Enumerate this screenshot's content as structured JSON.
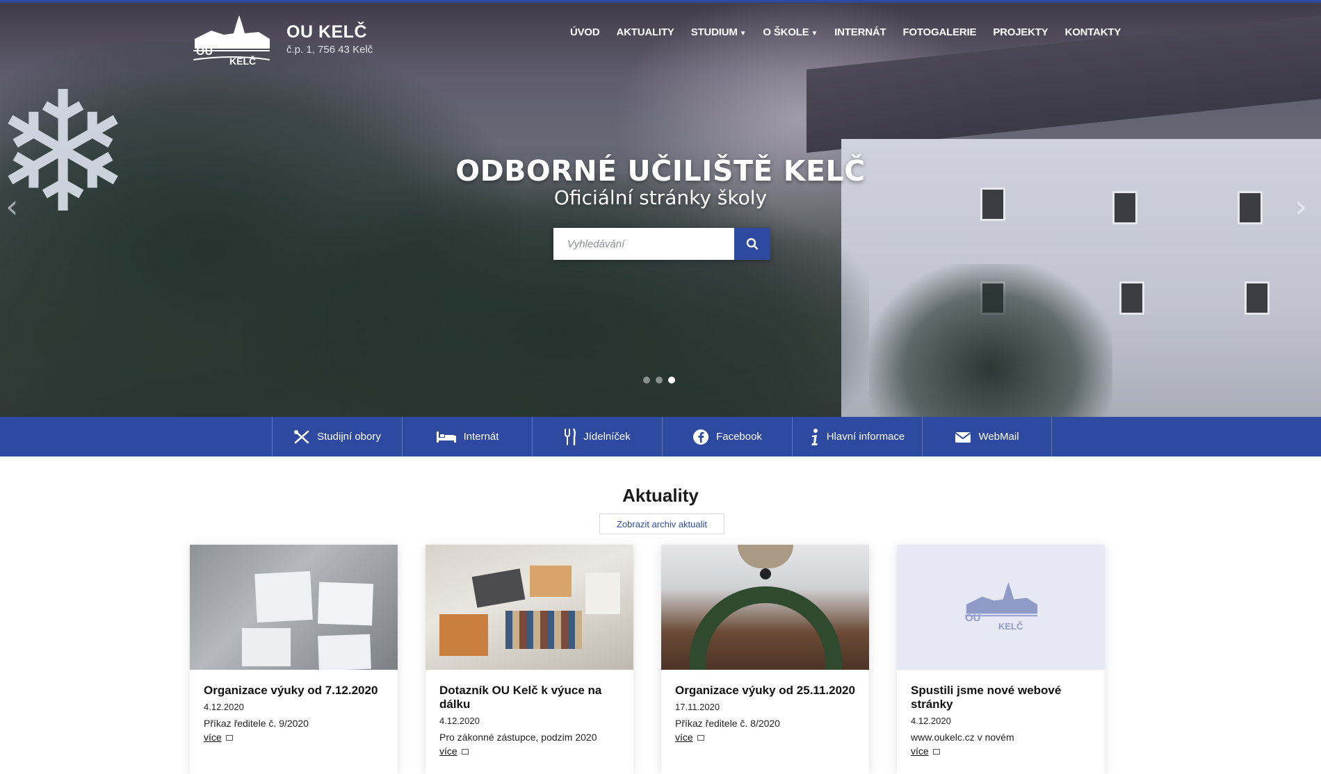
{
  "header": {
    "logo_text_top": "OU",
    "logo_text_bottom": "KELČ",
    "title": "OU KELČ",
    "subtitle": "č.p. 1, 756 43 Kelč"
  },
  "nav": [
    {
      "label": "ÚVOD",
      "dropdown": false
    },
    {
      "label": "AKTUALITY",
      "dropdown": false
    },
    {
      "label": "STUDIUM",
      "dropdown": true
    },
    {
      "label": "O ŠKOLE",
      "dropdown": true
    },
    {
      "label": "INTERNÁT",
      "dropdown": false
    },
    {
      "label": "FOTOGALERIE",
      "dropdown": false
    },
    {
      "label": "PROJEKTY",
      "dropdown": false
    },
    {
      "label": "KONTAKTY",
      "dropdown": false
    }
  ],
  "hero": {
    "title": "ODBORNÉ UČILIŠTĚ KELČ",
    "subtitle": "Oficiální stránky školy",
    "search_placeholder": "Vyhledávání",
    "slide_count": 3,
    "active_slide": 3
  },
  "quicklinks": [
    {
      "label": "Studijní obory",
      "icon": "tools-icon"
    },
    {
      "label": "Internát",
      "icon": "bed-icon"
    },
    {
      "label": "Jídelníček",
      "icon": "cutlery-icon"
    },
    {
      "label": "Facebook",
      "icon": "facebook-icon"
    },
    {
      "label": "Hlavní informace",
      "icon": "info-icon"
    },
    {
      "label": "WebMail",
      "icon": "mail-icon"
    }
  ],
  "news": {
    "title": "Aktuality",
    "archive_label": "Zobrazit archiv aktualit",
    "items": [
      {
        "title": "Organizace výuky od 7.12.2020",
        "date": "4.12.2020",
        "text": "Příkaz ředitele č. 9/2020",
        "more": "více"
      },
      {
        "title": "Dotazník OU Kelč k výuce na dálku",
        "date": "4.12.2020",
        "text": "Pro zákonné zástupce, podzim 2020",
        "more": "více"
      },
      {
        "title": "Organizace výuky od 25.11.2020",
        "date": "17.11.2020",
        "text": "Příkaz ředitele č. 8/2020",
        "more": "více"
      },
      {
        "title": "Spustili jsme nové webové stránky",
        "date": "4.12.2020",
        "text": "www.oukelc.cz v novém",
        "more": "více"
      }
    ]
  },
  "colors": {
    "primary": "#2d4aa0",
    "placeholder_image": "#e6e9f3"
  }
}
